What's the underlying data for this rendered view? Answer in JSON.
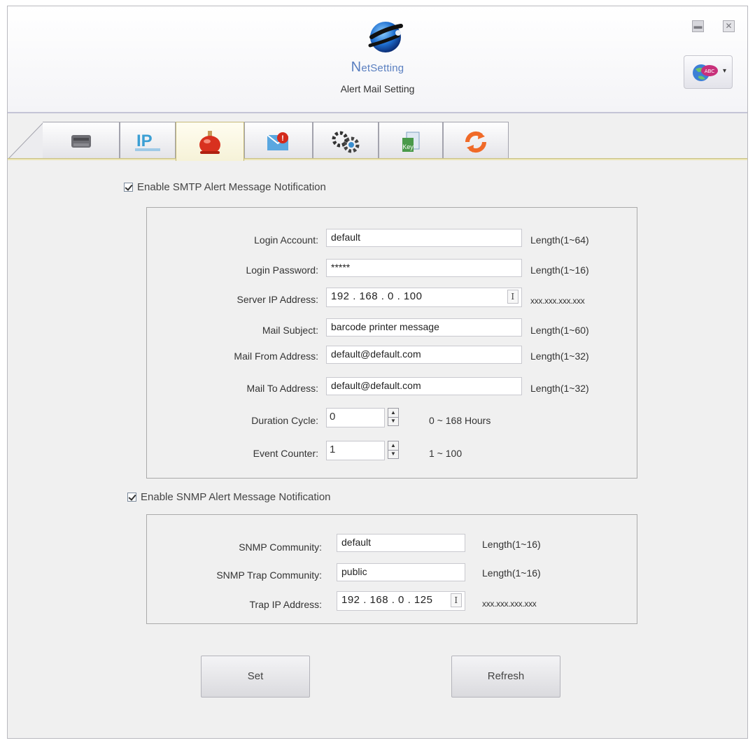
{
  "header": {
    "brand_initial": "N",
    "brand_rest": "etSetting",
    "subtitle": "Alert Mail Setting",
    "minimize_glyph": "▬",
    "close_glyph": "✕",
    "language_caret": "▾",
    "language_icon": "globe-abc-icon"
  },
  "tabs": [
    {
      "icon": "printer-icon",
      "active": false
    },
    {
      "icon": "ip-network-icon",
      "active": false
    },
    {
      "icon": "alert-beacon-icon",
      "active": true
    },
    {
      "icon": "mail-alert-icon",
      "active": false
    },
    {
      "icon": "gears-icon",
      "active": false
    },
    {
      "icon": "key-document-icon",
      "active": false
    },
    {
      "icon": "refresh-arrows-icon",
      "active": false
    }
  ],
  "smtp": {
    "enable_label": "Enable SMTP Alert Message Notification",
    "enabled": true,
    "login_account": {
      "label": "Login Account:",
      "value": "default",
      "hint": "Length(1~64)"
    },
    "login_password": {
      "label": "Login Password:",
      "value": "*****",
      "hint": "Length(1~16)"
    },
    "server_ip": {
      "label": "Server IP Address:",
      "value": "192 . 168 . 0 . 100",
      "hint": "xxx.xxx.xxx.xxx",
      "ip_glyph": "I"
    },
    "mail_subject": {
      "label": "Mail Subject:",
      "value": "barcode printer message",
      "hint": "Length(1~60)"
    },
    "mail_from": {
      "label": "Mail From Address:",
      "value": "default@default.com",
      "hint": "Length(1~32)"
    },
    "mail_to": {
      "label": "Mail To Address:",
      "value": "default@default.com",
      "hint": "Length(1~32)"
    },
    "duration_cycle": {
      "label": "Duration Cycle:",
      "value": "0",
      "hint": "0 ~ 168 Hours"
    },
    "event_counter": {
      "label": "Event Counter:",
      "value": "1",
      "hint": "1 ~ 100"
    },
    "spin_up": "▲",
    "spin_down": "▼"
  },
  "snmp": {
    "enable_label": "Enable SNMP Alert Message Notification",
    "enabled": true,
    "community": {
      "label": "SNMP Community:",
      "value": "default",
      "hint": "Length(1~16)"
    },
    "trap_community": {
      "label": "SNMP Trap Community:",
      "value": "public",
      "hint": "Length(1~16)"
    },
    "trap_ip": {
      "label": "Trap IP Address:",
      "value": "192 . 168 . 0 . 125",
      "hint": "xxx.xxx.xxx.xxx",
      "ip_glyph": "I"
    }
  },
  "buttons": {
    "set": "Set",
    "refresh": "Refresh"
  }
}
